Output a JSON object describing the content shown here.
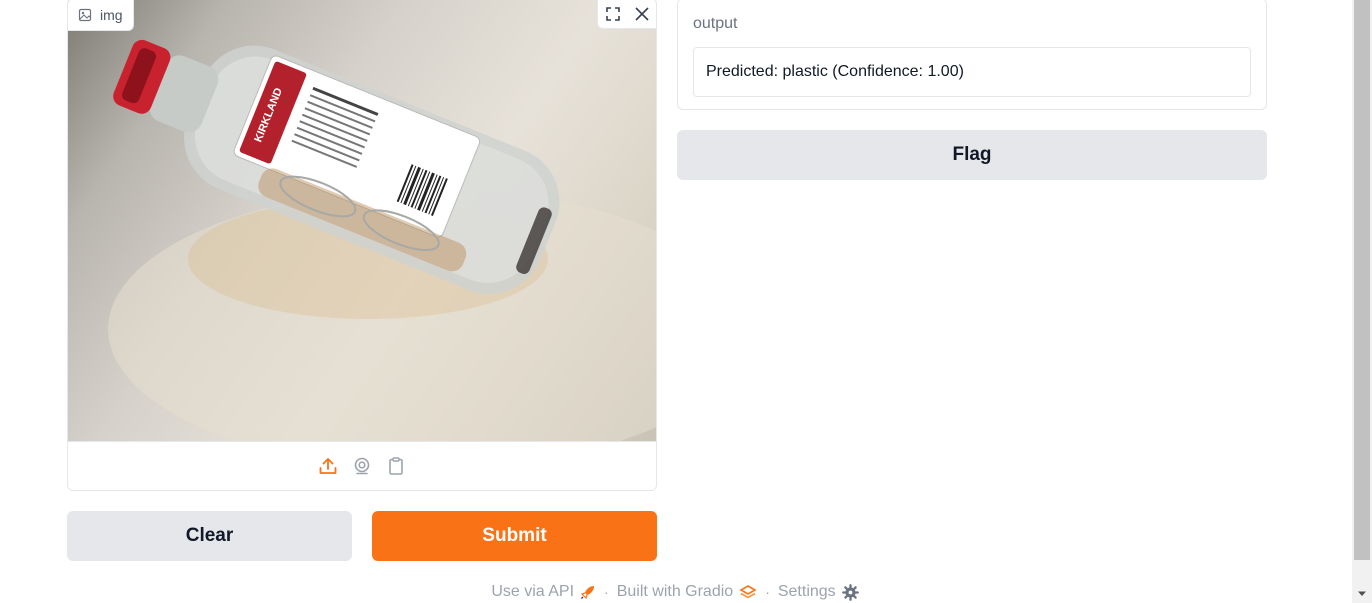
{
  "input": {
    "label": "img",
    "label_icon": "image-icon",
    "fullscreen_icon": "fullscreen-icon",
    "close_icon": "close-icon",
    "photo_text": "KIRKLAND",
    "sources": [
      {
        "icon": "upload-icon"
      },
      {
        "icon": "webcam-icon"
      },
      {
        "icon": "clipboard-icon"
      }
    ]
  },
  "buttons": {
    "clear": "Clear",
    "submit": "Submit",
    "flag": "Flag"
  },
  "output": {
    "label": "output",
    "value": "Predicted: plastic (Confidence: 1.00)"
  },
  "footer": {
    "api": "Use via API",
    "api_icon": "rocket-icon",
    "sep": "·",
    "built": "Built with Gradio",
    "built_icon": "gradio-logo-icon",
    "settings": "Settings",
    "settings_icon": "gear-icon"
  },
  "colors": {
    "accent": "#f97316",
    "secondary_button": "#e5e7eb",
    "border": "#e5e7eb",
    "muted_text": "#9ca3af"
  }
}
